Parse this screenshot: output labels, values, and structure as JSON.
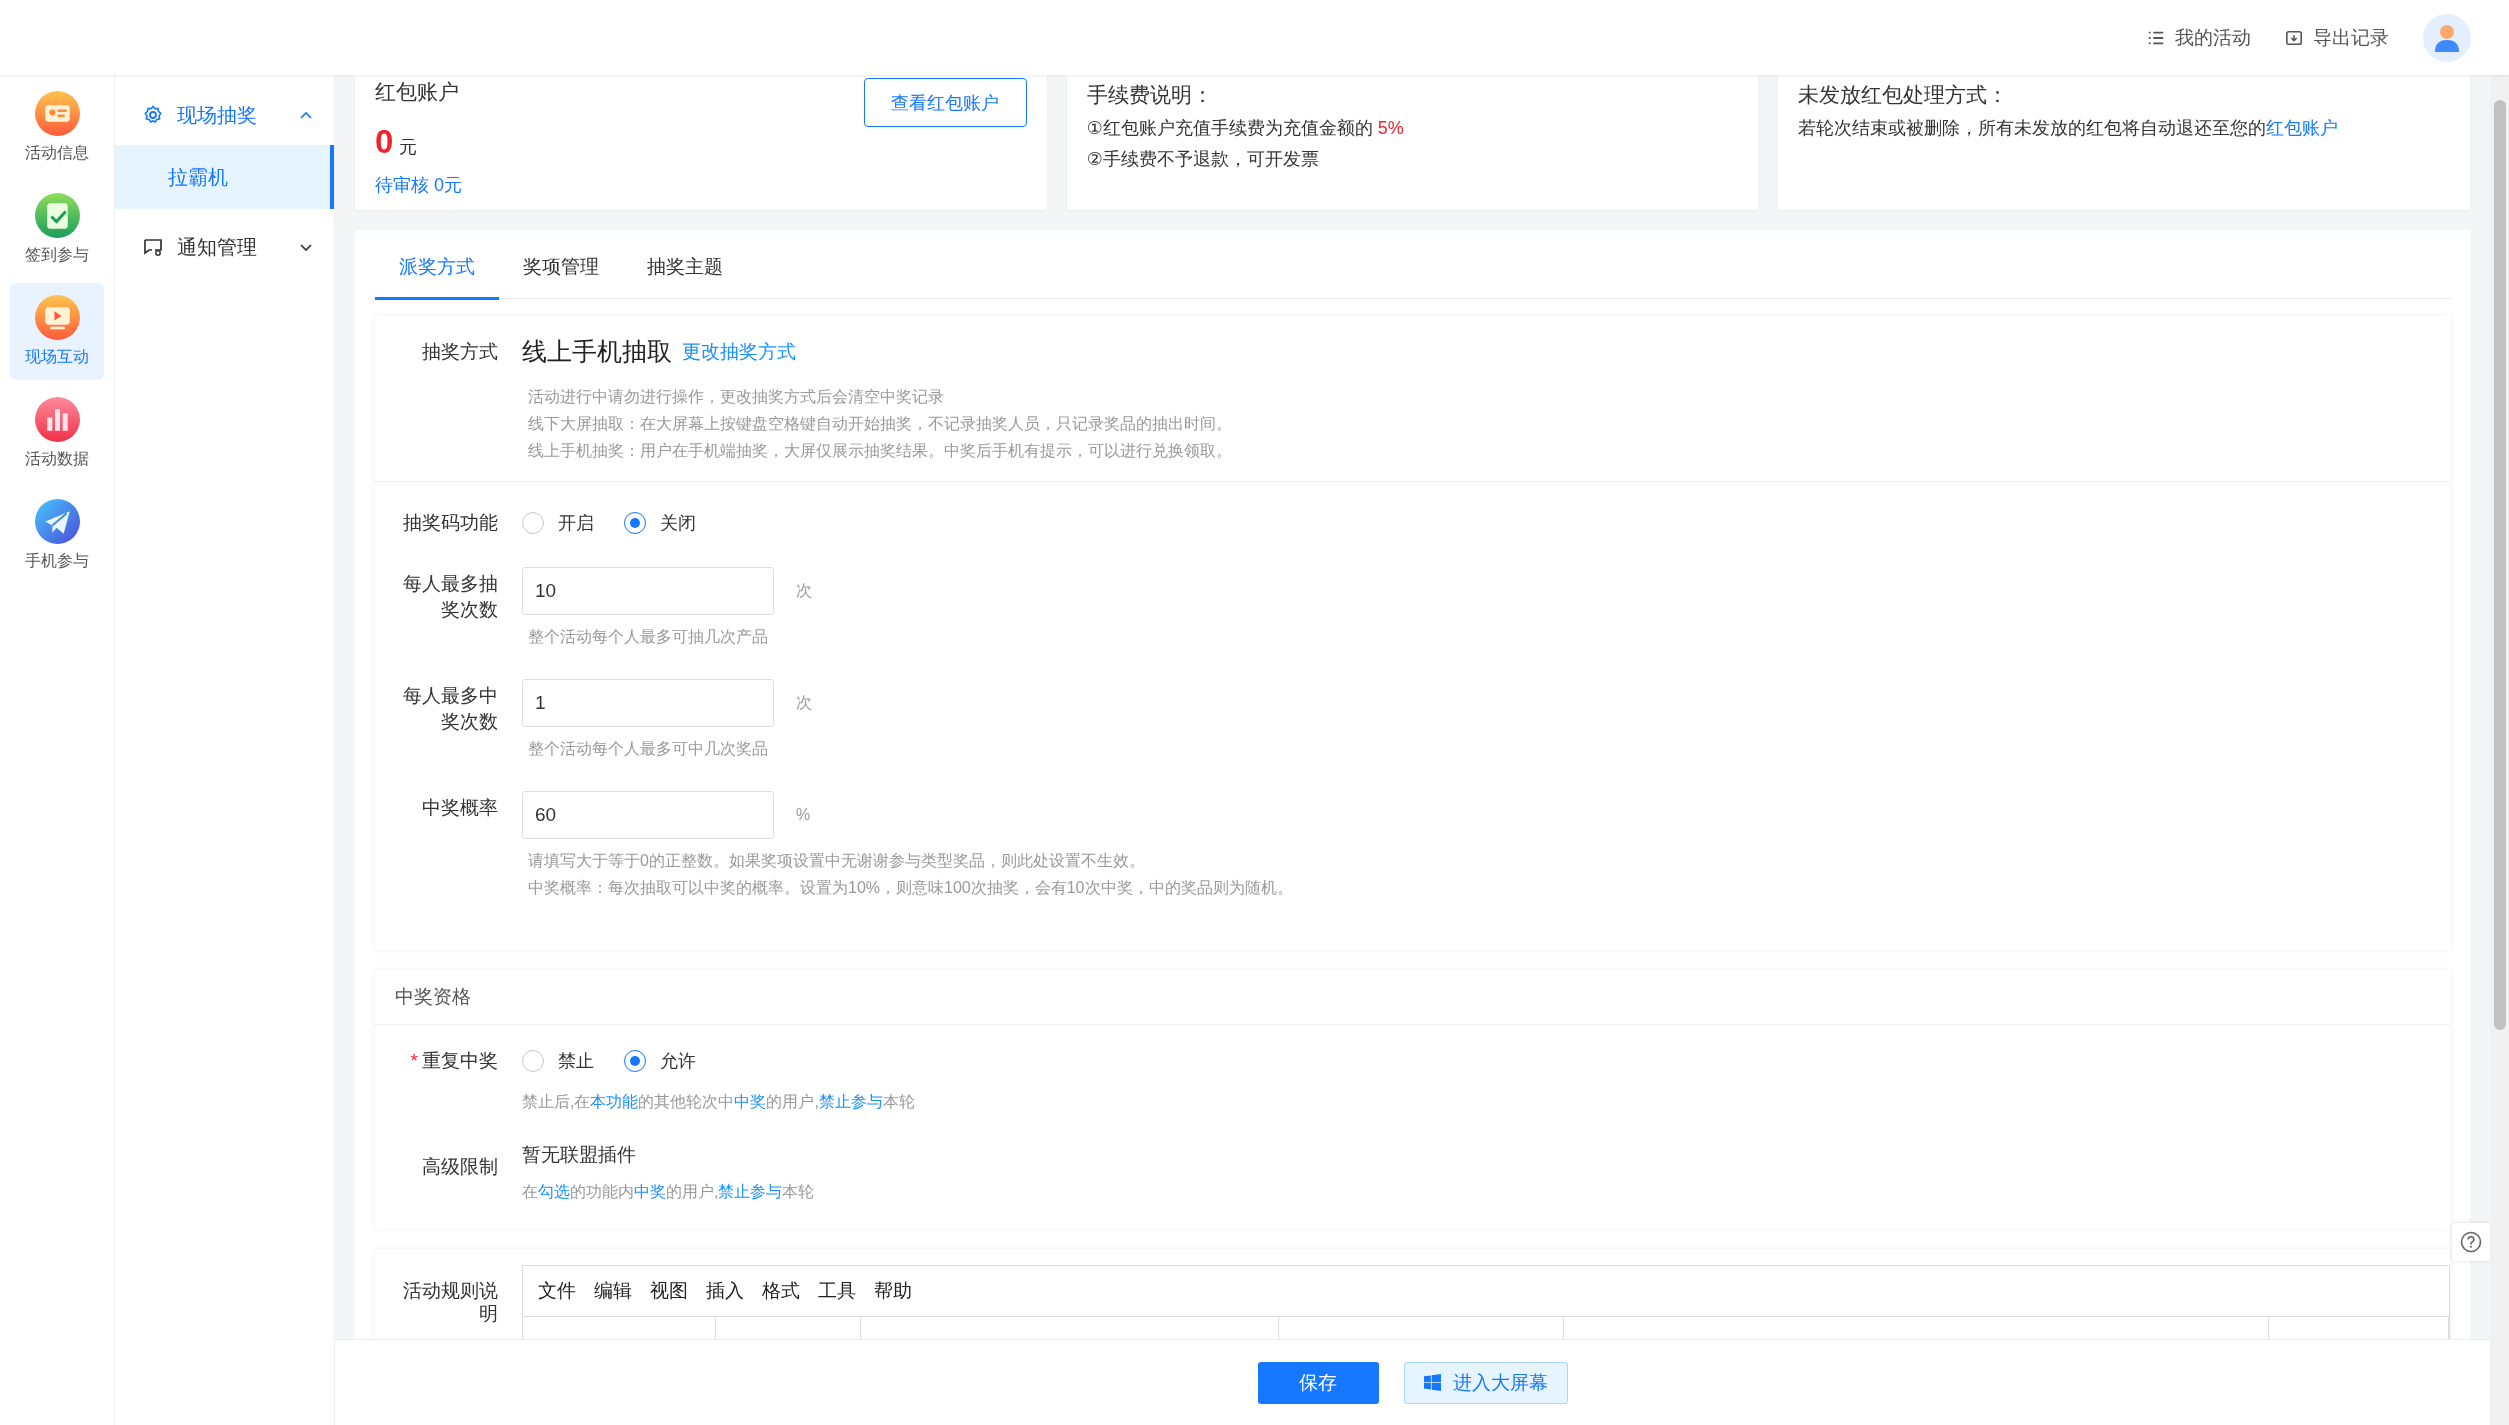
{
  "topbar": {
    "links": [
      {
        "label": "我的活动"
      },
      {
        "label": "导出记录"
      }
    ]
  },
  "rail": [
    {
      "label": "活动信息",
      "selected": false
    },
    {
      "label": "签到参与",
      "selected": false
    },
    {
      "label": "现场互动",
      "selected": true
    },
    {
      "label": "活动数据",
      "selected": false
    },
    {
      "label": "手机参与",
      "selected": false
    }
  ],
  "menu": [
    {
      "label": "现场抽奖",
      "expanded": true,
      "children": [
        {
          "label": "拉霸机",
          "selected": true
        }
      ]
    },
    {
      "label": "通知管理",
      "expanded": false
    }
  ],
  "account_card": {
    "title": "红包账户",
    "button": "查看红包账户",
    "amount": "0",
    "unit": "元",
    "pending": "待审核 0元"
  },
  "fee_card": {
    "title": "手续费说明：",
    "lines": [
      [
        {
          "kind": "text",
          "text": "①红包账户充值手续费为充值金额的 "
        },
        {
          "kind": "highlight",
          "text": "5%"
        }
      ],
      [
        {
          "kind": "text",
          "text": "②手续费不予退款，可开发票"
        }
      ]
    ]
  },
  "refund_card": {
    "title": "未发放红包处理方式：",
    "lines": [
      [
        {
          "kind": "text",
          "text": "若轮次结束或被删除，所有未发放的红包将自动退还至您的"
        },
        {
          "kind": "link",
          "text": "红包账户"
        }
      ]
    ]
  },
  "tabs": [
    {
      "label": "派奖方式",
      "selected": true
    },
    {
      "label": "奖项管理",
      "selected": false
    },
    {
      "label": "抽奖主题",
      "selected": false
    }
  ],
  "draw_method": {
    "label": "抽奖方式",
    "value": "线上手机抽取",
    "link": "更改抽奖方式",
    "notes": [
      "活动进行中请勿进行操作，更改抽奖方式后会清空中奖记录",
      "线下大屏抽取：在大屏幕上按键盘空格键自动开始抽奖，不记录抽奖人员，只记录奖品的抽出时间。",
      "线上手机抽奖：用户在手机端抽奖，大屏仅展示抽奖结果。中奖后手机有提示，可以进行兑换领取。"
    ]
  },
  "settings": [
    {
      "kind": "radio",
      "label": "抽奖码功能",
      "options": [
        {
          "label": "开启",
          "selected": false
        },
        {
          "label": "关闭",
          "selected": true
        }
      ]
    },
    {
      "kind": "input",
      "label": "每人最多抽奖次数",
      "value": "10",
      "unit": "次",
      "hints": [
        "整个活动每个人最多可抽几次产品"
      ]
    },
    {
      "kind": "input",
      "label": "每人最多中奖次数",
      "value": "1",
      "unit": "次",
      "hints": [
        "整个活动每个人最多可中几次奖品"
      ]
    },
    {
      "kind": "input",
      "label": "中奖概率",
      "value": "60",
      "unit": "%",
      "hints": [
        "请填写大于等于0的正整数。如果奖项设置中无谢谢参与类型奖品，则此处设置不生效。",
        "中奖概率：每次抽取可以中奖的概率。设置为10%，则意味100次抽奖，会有10次中奖，中的奖品则为随机。"
      ]
    }
  ],
  "qualification": {
    "title": "中奖资格",
    "repeat_win": {
      "label": "重复中奖",
      "required_mark": "*",
      "options": [
        {
          "label": "禁止",
          "selected": false
        },
        {
          "label": "允许",
          "selected": true
        }
      ],
      "hint": [
        {
          "kind": "text",
          "text": "禁止后,在"
        },
        {
          "kind": "link",
          "text": "本功能"
        },
        {
          "kind": "text",
          "text": "的其他轮次中"
        },
        {
          "kind": "link",
          "text": "中奖"
        },
        {
          "kind": "text",
          "text": "的用户,"
        },
        {
          "kind": "link",
          "text": "禁止参与"
        },
        {
          "kind": "text",
          "text": "本轮"
        }
      ]
    },
    "advanced": {
      "label": "高级限制",
      "value": "暂无联盟插件",
      "hint": [
        {
          "kind": "text",
          "text": "在"
        },
        {
          "kind": "link",
          "text": "勾选"
        },
        {
          "kind": "text",
          "text": "的功能内"
        },
        {
          "kind": "link",
          "text": "中奖"
        },
        {
          "kind": "text",
          "text": "的用户,"
        },
        {
          "kind": "link",
          "text": "禁止参与"
        },
        {
          "kind": "text",
          "text": "本轮"
        }
      ]
    }
  },
  "rules_editor": {
    "label": "活动规则说明",
    "menu": [
      "文件",
      "编辑",
      "视图",
      "插入",
      "格式",
      "工具",
      "帮助"
    ]
  },
  "footer": {
    "buttons": [
      {
        "kind": "primary",
        "label": "保存"
      },
      {
        "kind": "secondary",
        "label": "进入大屏幕"
      }
    ]
  }
}
